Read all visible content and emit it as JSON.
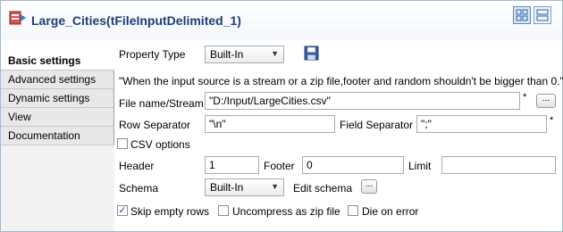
{
  "header": {
    "title": "Large_Cities(tFileInputDelimited_1)",
    "title_icon": "component-icon",
    "view_buttons": [
      "grid-view-icon",
      "list-view-icon"
    ]
  },
  "sidebar": {
    "items": [
      {
        "label": "Basic settings",
        "active": true
      },
      {
        "label": "Advanced settings"
      },
      {
        "label": "Dynamic settings"
      },
      {
        "label": "View"
      },
      {
        "label": "Documentation"
      }
    ]
  },
  "form": {
    "property_type_label": "Property Type",
    "property_type_value": "Built-In",
    "save_icon": "save-icon",
    "note": "\"When the input source is a stream or a zip file,footer and random shouldn't be bigger than 0.\"",
    "file_name_label": "File name/Stream",
    "file_name_value": "\"D:/Input/LargeCities.csv\"",
    "required_mark": "*",
    "browse_label": "...",
    "row_separator_label": "Row Separator",
    "row_separator_value": "\"\\n\"",
    "field_separator_label": "Field Separator",
    "field_separator_value": "\";\"",
    "csv_options_label": "CSV options",
    "csv_options_checked": false,
    "header_label": "Header",
    "header_value": "1",
    "footer_label": "Footer",
    "footer_value": "0",
    "limit_label": "Limit",
    "limit_value": "",
    "schema_label": "Schema",
    "schema_value": "Built-In",
    "edit_schema_label": "Edit schema",
    "edit_schema_button": "...",
    "skip_empty_rows_label": "Skip empty rows",
    "skip_empty_rows_checked": true,
    "uncompress_label": "Uncompress as zip file",
    "uncompress_checked": false,
    "die_on_error_label": "Die on error",
    "die_on_error_checked": false
  },
  "colors": {
    "title": "#1a3e78",
    "border": "#a9b7c6",
    "sidebar_bg": "#e8e8e8"
  }
}
